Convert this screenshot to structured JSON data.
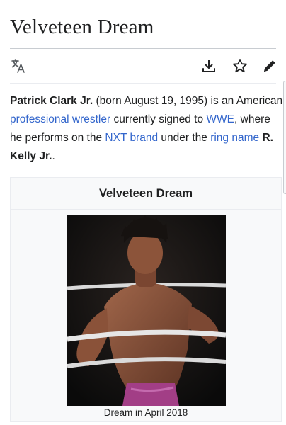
{
  "page": {
    "title": "Velveteen Dream"
  },
  "toolbar": {
    "language_icon": "translate-icon",
    "download_icon": "download-icon",
    "watch_icon": "star-icon",
    "edit_icon": "pencil-icon"
  },
  "lead": {
    "name": "Patrick Clark Jr.",
    "t1": " (born August 19, 1995) is an American ",
    "link_wrestler": "professional wrestler",
    "t2": " currently signed to ",
    "link_wwe": "WWE",
    "t3": ", where he performs on the ",
    "link_nxt": "NXT brand",
    "t4": " under the ",
    "link_ring": "ring name",
    "t5": " ",
    "ring_name": "R. Kelly Jr.",
    "t6": "."
  },
  "infobox": {
    "title": "Velveteen Dream",
    "image_caption": "Dream in April 2018"
  },
  "colors": {
    "link": "#3366cc",
    "text": "#202122",
    "infobox_bg": "#f8f9fa",
    "rule": "#c8ccd1"
  }
}
